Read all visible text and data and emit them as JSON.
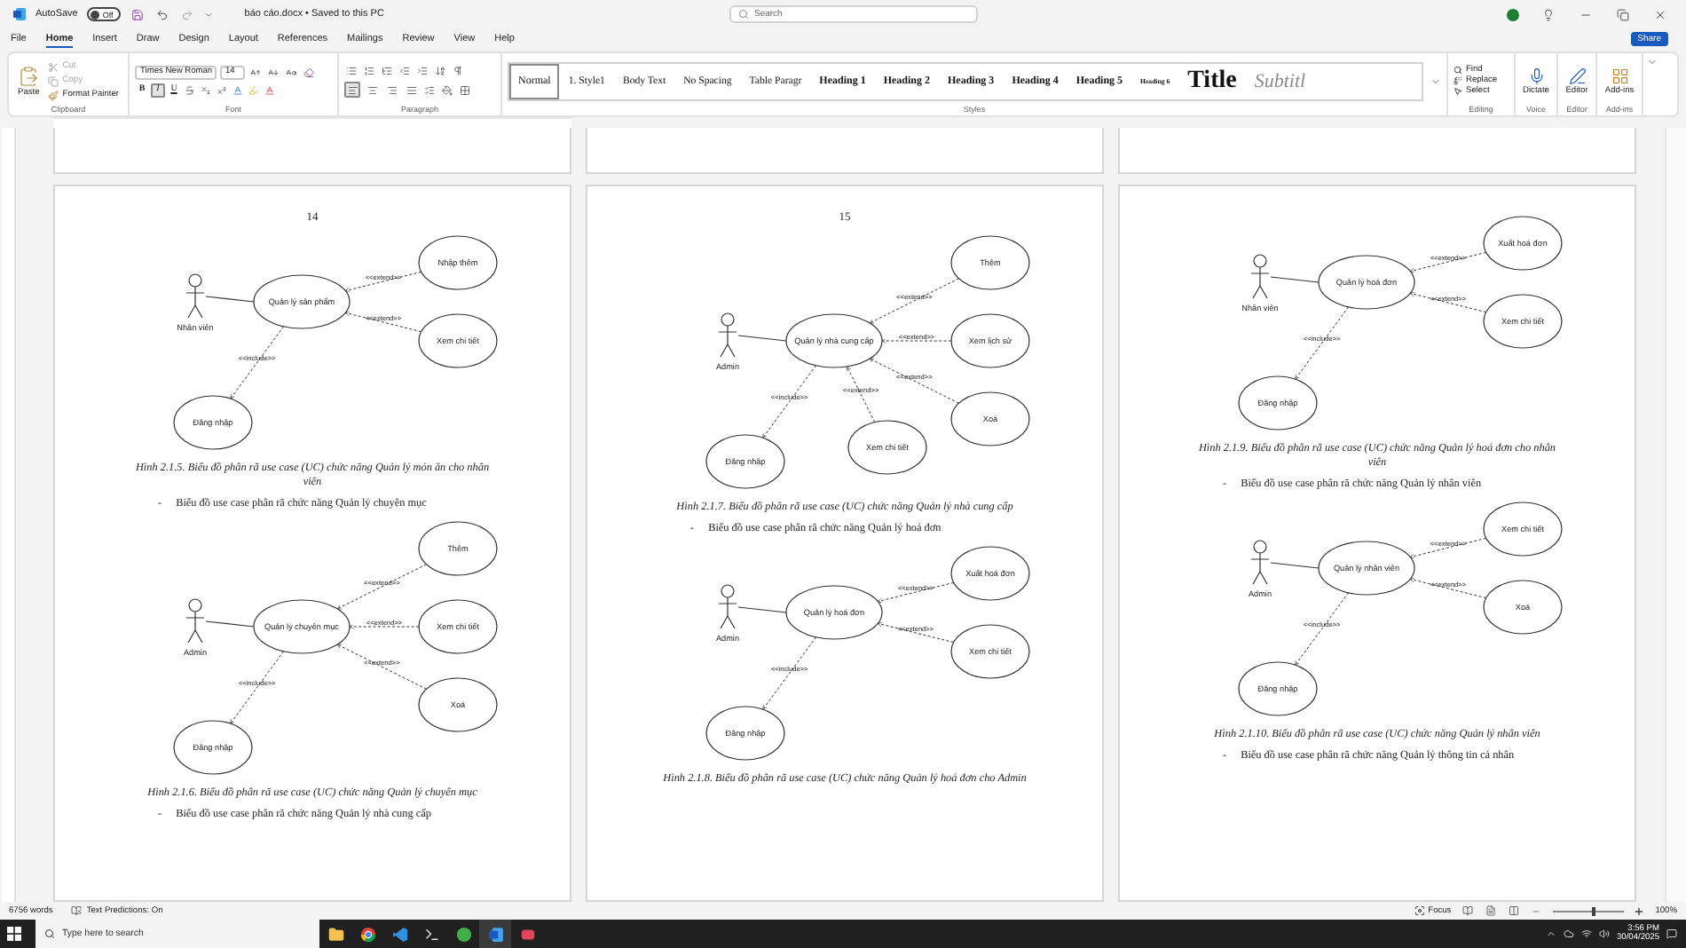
{
  "window": {
    "autosave_label": "AutoSave",
    "autosave": {
      "on": false,
      "label": "Off"
    },
    "file_title": "báo cáo.docx • Saved to this PC"
  },
  "search": {
    "placeholder": "Search"
  },
  "menu_tabs": [
    {
      "label": "File",
      "selected": false
    },
    {
      "label": "Home",
      "selected": true
    },
    {
      "label": "Insert",
      "selected": false
    },
    {
      "label": "Draw",
      "selected": false
    },
    {
      "label": "Design",
      "selected": false
    },
    {
      "label": "Layout",
      "selected": false
    },
    {
      "label": "References",
      "selected": false
    },
    {
      "label": "Mailings",
      "selected": false
    },
    {
      "label": "Review",
      "selected": false
    },
    {
      "label": "View",
      "selected": false
    },
    {
      "label": "Help",
      "selected": false
    }
  ],
  "share": "Share",
  "ribbon": {
    "clipboard": {
      "label": "Clipboard",
      "paste": "Paste",
      "items": [
        {
          "label": "Cut",
          "disabled": true
        },
        {
          "label": "Copy",
          "disabled": true
        },
        {
          "label": "Format Painter",
          "disabled": false
        }
      ]
    },
    "font": {
      "label": "Font",
      "font_name": "Times New Roman",
      "font_size": "14",
      "format_buttons": [
        {
          "label": "B",
          "selected": false
        },
        {
          "label": "I",
          "selected": true
        },
        {
          "label": "U",
          "selected": false
        }
      ]
    },
    "paragraph": {
      "label": "Paragraph",
      "alignments": [
        {
          "selected": true
        },
        {
          "selected": false
        },
        {
          "selected": false
        },
        {
          "selected": false
        }
      ]
    },
    "styles": {
      "label": "Styles",
      "items": [
        {
          "label": "Normal",
          "kind": "normal",
          "selected": true
        },
        {
          "label": "1. Style1",
          "kind": "body",
          "selected": false
        },
        {
          "label": "Body Text",
          "kind": "body",
          "selected": false
        },
        {
          "label": "No Spacing",
          "kind": "body",
          "selected": false
        },
        {
          "label": "Table Paragr",
          "kind": "body",
          "selected": false
        },
        {
          "label": "Heading 1",
          "kind": "heading",
          "selected": false
        },
        {
          "label": "Heading 2",
          "kind": "heading",
          "selected": false
        },
        {
          "label": "Heading 3",
          "kind": "heading",
          "selected": false
        },
        {
          "label": "Heading 4",
          "kind": "heading",
          "selected": false
        },
        {
          "label": "Heading 5",
          "kind": "heading",
          "selected": false
        },
        {
          "label": "Heading 6",
          "kind": "small_heading",
          "selected": false
        },
        {
          "label": "Title",
          "kind": "title",
          "selected": false
        },
        {
          "label": "Subtitl",
          "kind": "subtitle",
          "selected": false
        }
      ]
    },
    "editing": {
      "label": "Editing",
      "items": [
        "Find",
        "Replace",
        "Select"
      ]
    },
    "voice": {
      "label": "Voice",
      "button": "Dictate"
    },
    "editor": {
      "label": "Editor",
      "button": "Editor"
    },
    "addins": {
      "label": "Add-ins",
      "button": "Add-ins"
    }
  },
  "pages": [
    {
      "blocks": [
        {
          "kind": "page_number",
          "text": "14"
        },
        {
          "kind": "diagram",
          "actor": "Nhân viên",
          "main": "Quản lý sản phẩm",
          "links": [
            {
              "kind": "extend",
              "label": "<<extend>>",
              "target": "Nhập thêm"
            },
            {
              "kind": "extend",
              "label": "<<extend>>",
              "target": "Xem chi tiết"
            },
            {
              "kind": "include",
              "label": "<<include>>",
              "target": "Đăng nhập"
            }
          ]
        },
        {
          "kind": "caption",
          "text": "Hình 2.1.5. Biểu đồ phân rã use case (UC) chức năng Quản lý món ăn cho nhân viên"
        },
        {
          "kind": "bullet",
          "marker": "-",
          "text": "Biểu đồ use case phân rã chức năng Quản lý chuyên mục"
        },
        {
          "kind": "diagram",
          "actor": "Admin",
          "main": "Quản lý chuyên mục",
          "links": [
            {
              "kind": "extend",
              "label": "<<extend>>",
              "target": "Thêm"
            },
            {
              "kind": "extend",
              "label": "<<extend>>",
              "target": "Xem chi tiết"
            },
            {
              "kind": "extend",
              "label": "<<extend>>",
              "target": "Xoá"
            },
            {
              "kind": "include",
              "label": "<<include>>",
              "target": "Đăng nhập"
            }
          ]
        },
        {
          "kind": "caption",
          "text": "Hình 2.1.6. Biểu đồ phân rã use case (UC) chức năng Quản lý chuyên mục"
        },
        {
          "kind": "bullet",
          "marker": "-",
          "text": "Biểu đồ use case phân rã chức năng Quản lý nhà cung cấp"
        }
      ]
    },
    {
      "blocks": [
        {
          "kind": "page_number",
          "text": "15"
        },
        {
          "kind": "diagram",
          "actor": "Admin",
          "main": "Quản lý nhà cung cấp",
          "links": [
            {
              "kind": "extend",
              "label": "<<extend>>",
              "target": "Thêm"
            },
            {
              "kind": "extend",
              "label": "<<extend>>",
              "target": "Xem lịch sử"
            },
            {
              "kind": "extend",
              "label": "<<extend>>",
              "target": "Xoá"
            },
            {
              "kind": "extend",
              "label": "<<extend>>",
              "target": "Xem chi tiết"
            },
            {
              "kind": "include",
              "label": "<<include>>",
              "target": "Đăng nhập"
            }
          ]
        },
        {
          "kind": "caption",
          "text": "Hình 2.1.7. Biểu đồ phân rã use case (UC) chức năng Quản lý nhà cung cấp"
        },
        {
          "kind": "bullet",
          "marker": "-",
          "text": "Biểu đồ use case phân rã chức năng Quản lý hoá đơn"
        },
        {
          "kind": "diagram",
          "actor": "Admin",
          "main": "Quản lý hoá đơn",
          "links": [
            {
              "kind": "extend",
              "label": "<<extend>>",
              "target": "Xuất hoá đơn"
            },
            {
              "kind": "extend",
              "label": "<<extend>>",
              "target": "Xem chi tiết"
            },
            {
              "kind": "include",
              "label": "<<include>>",
              "target": "Đăng nhập"
            }
          ]
        },
        {
          "kind": "caption",
          "text": "Hình 2.1.8. Biểu đồ phân rã use case (UC) chức năng Quản lý hoá đơn cho Admin"
        }
      ]
    },
    {
      "blocks": [
        {
          "kind": "diagram",
          "actor": "Nhân viên",
          "main": "Quản lý hoá đơn",
          "links": [
            {
              "kind": "extend",
              "label": "<<extend>>",
              "target": "Xuất hoá đơn"
            },
            {
              "kind": "extend",
              "label": "<<extend>>",
              "target": "Xem chi tiết"
            },
            {
              "kind": "include",
              "label": "<<include>>",
              "target": "Đăng nhập"
            }
          ]
        },
        {
          "kind": "caption",
          "text": "Hình 2.1.9. Biểu đồ phân rã use case (UC) chức năng Quản lý hoá đơn cho nhân viên"
        },
        {
          "kind": "bullet",
          "marker": "-",
          "text": "Biểu đồ use case phân rã chức năng Quản lý nhân viên"
        },
        {
          "kind": "diagram",
          "actor": "Admin",
          "main": "Quản lý nhân viên",
          "links": [
            {
              "kind": "extend",
              "label": "<<extend>>",
              "target": "Xem chi tiết"
            },
            {
              "kind": "extend",
              "label": "<<extend>>",
              "target": "Xoá"
            },
            {
              "kind": "include",
              "label": "<<include>>",
              "target": "Đăng nhập"
            }
          ]
        },
        {
          "kind": "caption",
          "text": "Hình 2.1.10. Biểu đồ phân rã use case (UC) chức năng Quản lý nhân viên"
        },
        {
          "kind": "bullet",
          "marker": "-",
          "text": "Biểu đồ use case phân rã chức năng Quản lý thông tin cá nhân"
        }
      ]
    }
  ],
  "status_bar": {
    "word_count": "6756 words",
    "text_predictions": "Text Predictions: On",
    "focus": "Focus",
    "zoom": {
      "level": 0.55,
      "reading": "100%"
    }
  },
  "taskbar": {
    "search_placeholder": "Type here to search",
    "time": "3:56 PM",
    "date": "30/04/2025"
  }
}
